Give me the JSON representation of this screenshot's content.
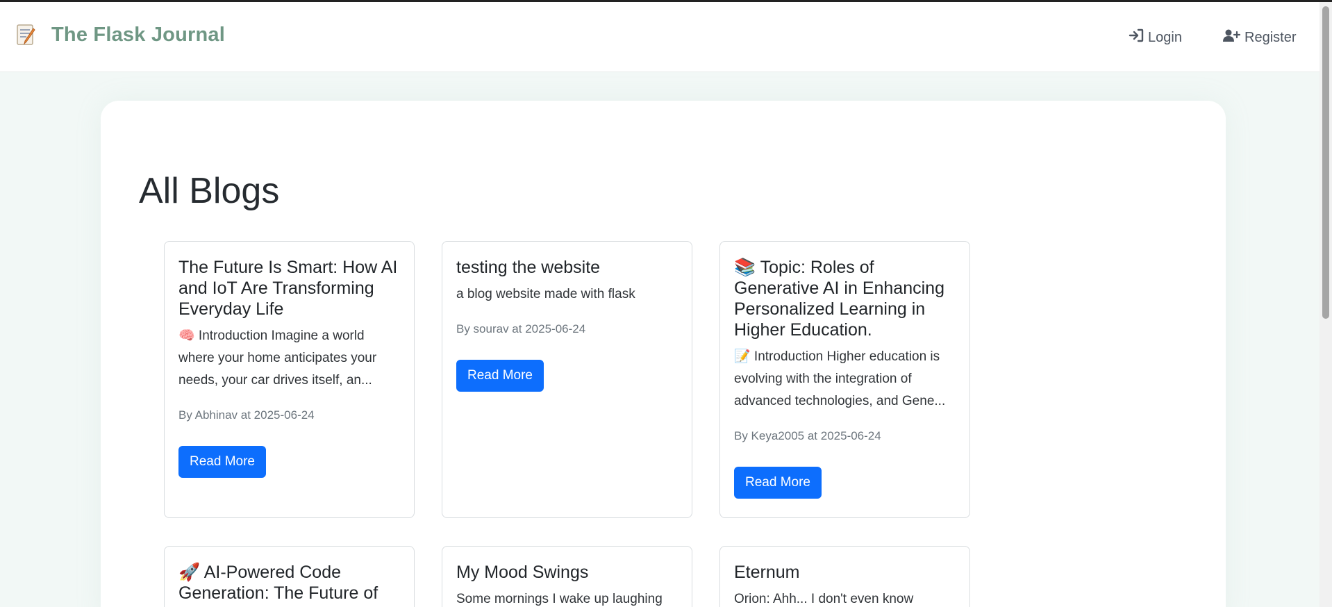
{
  "nav": {
    "brand": "The Flask Journal",
    "login": "Login",
    "register": "Register"
  },
  "page": {
    "title": "All Blogs"
  },
  "posts": [
    {
      "title": "The Future Is Smart: How AI and IoT Are Transforming Everyday Life",
      "excerpt": "🧠 Introduction Imagine a world where your home anticipates your needs, your car drives itself, an...",
      "meta": "By Abhinav at 2025-06-24",
      "button": "Read More"
    },
    {
      "title": "testing the website",
      "excerpt": "a blog website made with flask",
      "meta": "By sourav at 2025-06-24",
      "button": "Read More"
    },
    {
      "title": "📚 Topic: Roles of Generative AI in Enhancing Personalized Learning in Higher Education.",
      "excerpt": "📝 Introduction Higher education is evolving with the integration of advanced technologies, and Gene...",
      "meta": "By Keya2005 at 2025-06-24",
      "button": "Read More"
    },
    {
      "title": "🚀 AI-Powered Code Generation: The Future of Programming? (Will AI...",
      "excerpt": ""
    },
    {
      "title": "My Mood Swings",
      "excerpt": "Some mornings I wake up laughing"
    },
    {
      "title": "Eternum",
      "excerpt": "Orion: Ahh... I don't even know"
    }
  ],
  "icons": {
    "brand": "notepad-icon",
    "login": "sign-in-icon",
    "register": "user-plus-icon"
  },
  "colors": {
    "brand": "#6f9784",
    "button": "#0d6efd",
    "background": "#f2f8f6"
  }
}
